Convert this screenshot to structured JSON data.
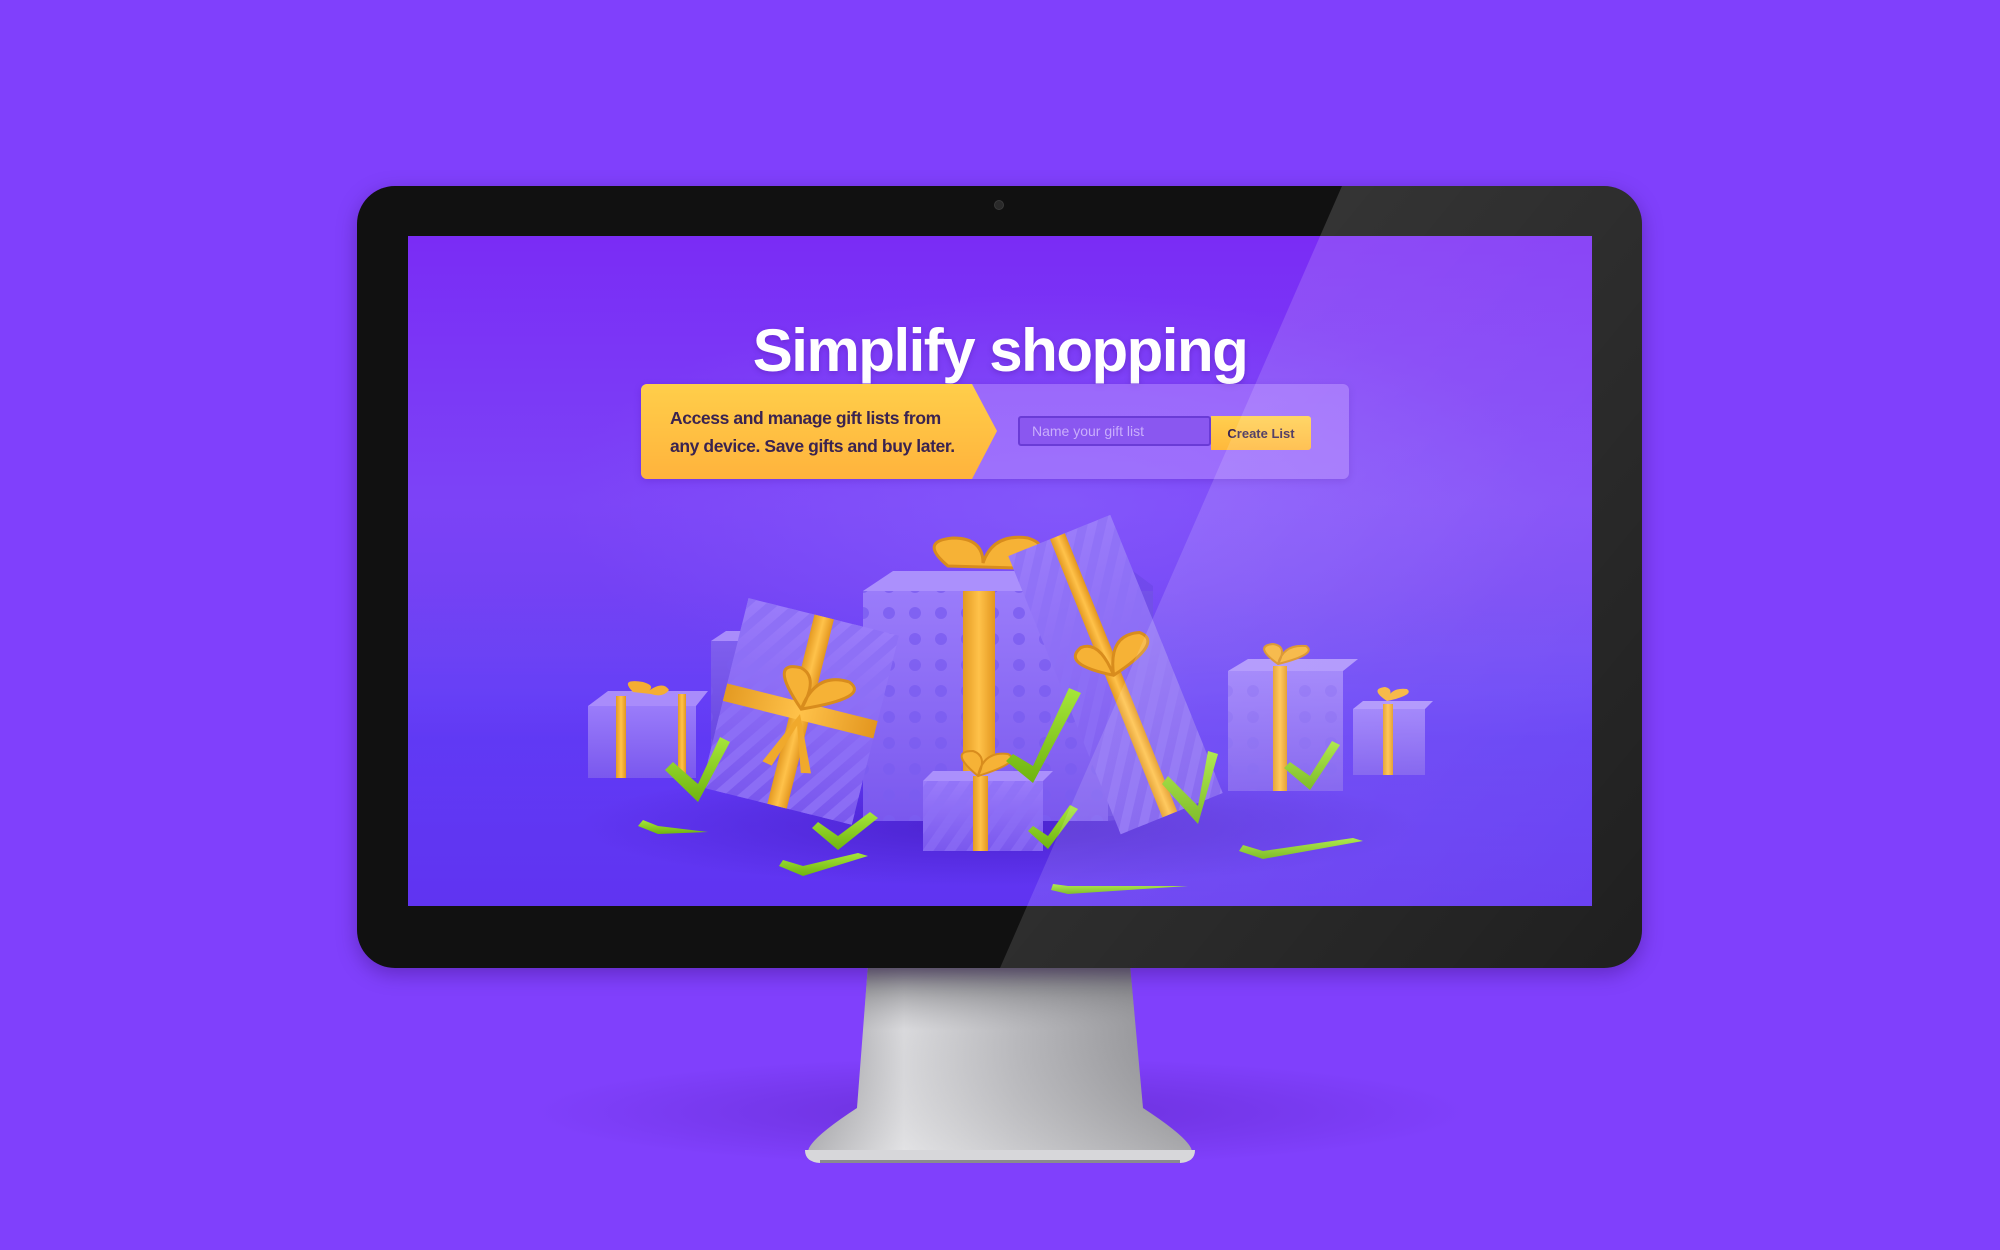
{
  "hero": {
    "headline": "Simplify shopping",
    "description": "Access and manage gift lists from any device. Save gifts and buy later.",
    "input_placeholder": "Name your gift list",
    "button_label": "Create List"
  },
  "colors": {
    "page_background": "#8040fc",
    "screen_background": "#7a2cf5",
    "accent_yellow": "#ffc13f",
    "gift_purple": "#8a6cf4",
    "checkmark_green": "#8bd21c",
    "bezel": "#111111"
  },
  "icons": [
    "gift-boxes-illustration",
    "checkmark-icon"
  ]
}
